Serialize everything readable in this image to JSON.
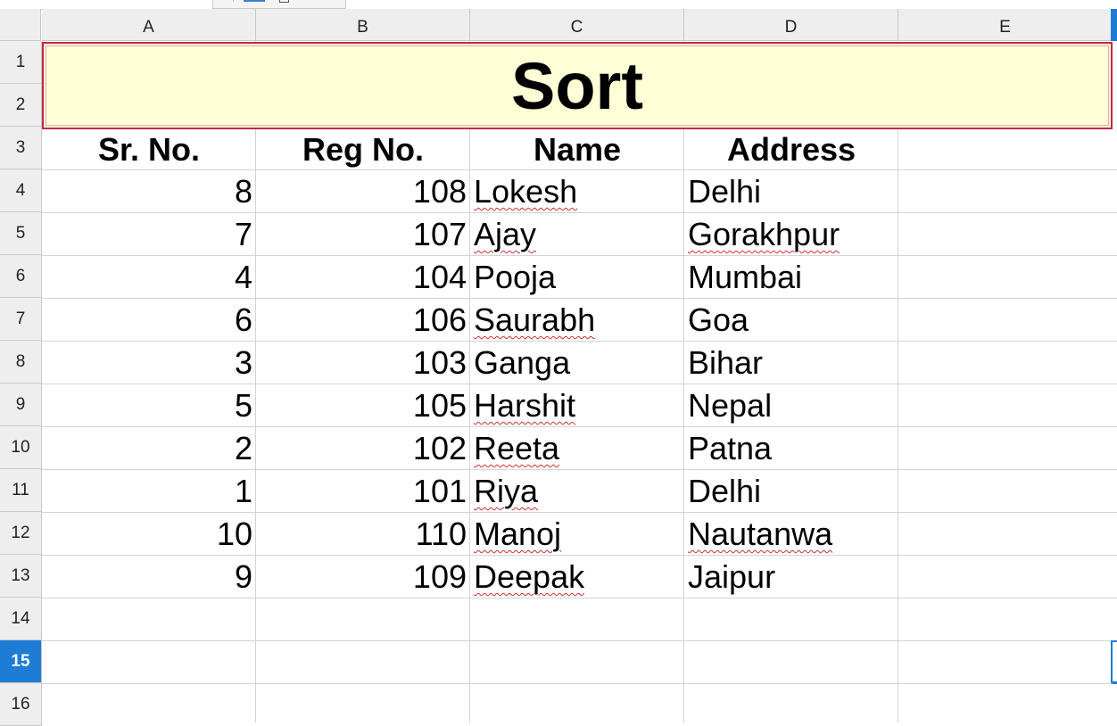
{
  "columns": [
    "A",
    "B",
    "C",
    "D",
    "E"
  ],
  "rows": [
    "1",
    "2",
    "3",
    "4",
    "5",
    "6",
    "7",
    "8",
    "9",
    "10",
    "11",
    "12",
    "13",
    "14",
    "15",
    "16"
  ],
  "active_row": "15",
  "title": "Sort",
  "headers": {
    "sr": "Sr. No.",
    "reg": "Reg No.",
    "name": "Name",
    "address": "Address"
  },
  "records": [
    {
      "sr": "8",
      "reg": "108",
      "name": "Lokesh",
      "address": "Delhi"
    },
    {
      "sr": "7",
      "reg": "107",
      "name": "Ajay",
      "address": "Gorakhpur"
    },
    {
      "sr": "4",
      "reg": "104",
      "name": "Pooja",
      "address": "Mumbai"
    },
    {
      "sr": "6",
      "reg": "106",
      "name": "Saurabh",
      "address": "Goa"
    },
    {
      "sr": "3",
      "reg": "103",
      "name": "Ganga",
      "address": "Bihar"
    },
    {
      "sr": "5",
      "reg": "105",
      "name": "Harshit",
      "address": "Nepal"
    },
    {
      "sr": "2",
      "reg": "102",
      "name": "Reeta",
      "address": "Patna"
    },
    {
      "sr": "1",
      "reg": "101",
      "name": "Riya",
      "address": "Delhi"
    },
    {
      "sr": "10",
      "reg": "110",
      "name": "Manoj",
      "address": "Nautanwa"
    },
    {
      "sr": "9",
      "reg": "109",
      "name": "Deepak",
      "address": "Jaipur"
    }
  ],
  "colors": {
    "title_fill": "#ffffd7",
    "title_border": "#c0294a",
    "accent": "#1e7bd6",
    "spellcheck": "#d03030"
  }
}
